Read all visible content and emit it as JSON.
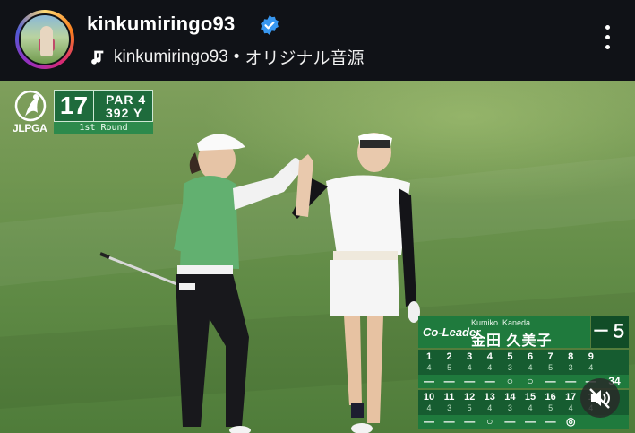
{
  "header": {
    "username": "kinkumiringo93",
    "verified_icon": "verified-badge-icon",
    "audio_owner": "kinkumiringo93",
    "audio_separator": "•",
    "audio_title": "オリジナル音源",
    "music_icon": "music-note-icon",
    "more_icon": "more-vertical-icon"
  },
  "broadcast": {
    "logo_text": "JLPGA",
    "hole_number": "17",
    "par": "PAR 4",
    "yardage": "392 Y",
    "round": "1st Round"
  },
  "scorecard": {
    "position": "Co-Leader",
    "player_first_romaji": "Kumiko",
    "player_last_romaji": "Kaneda",
    "player_name_jp": "金田 久美子",
    "total_to_par": "－５",
    "front_nine": {
      "holes": [
        "1",
        "2",
        "3",
        "4",
        "5",
        "6",
        "7",
        "8",
        "9"
      ],
      "pars": [
        "4",
        "5",
        "4",
        "4",
        "3",
        "4",
        "5",
        "3",
        "4"
      ],
      "results": [
        "—",
        "—",
        "—",
        "—",
        "○",
        "○",
        "—",
        "—",
        "—"
      ],
      "total": "34"
    },
    "back_nine": {
      "holes": [
        "10",
        "11",
        "12",
        "13",
        "14",
        "15",
        "16",
        "17",
        "1"
      ],
      "pars": [
        "4",
        "3",
        "5",
        "4",
        "3",
        "4",
        "5",
        "4",
        "4"
      ],
      "results": [
        "—",
        "—",
        "—",
        "○",
        "—",
        "—",
        "—",
        "◎",
        ""
      ]
    }
  },
  "controls": {
    "mute_icon": "speaker-muted-icon"
  },
  "colors": {
    "header_bg": "#101217",
    "verified": "#3897f0",
    "card_green": "#1f7a3d",
    "card_dark": "#165c30"
  }
}
